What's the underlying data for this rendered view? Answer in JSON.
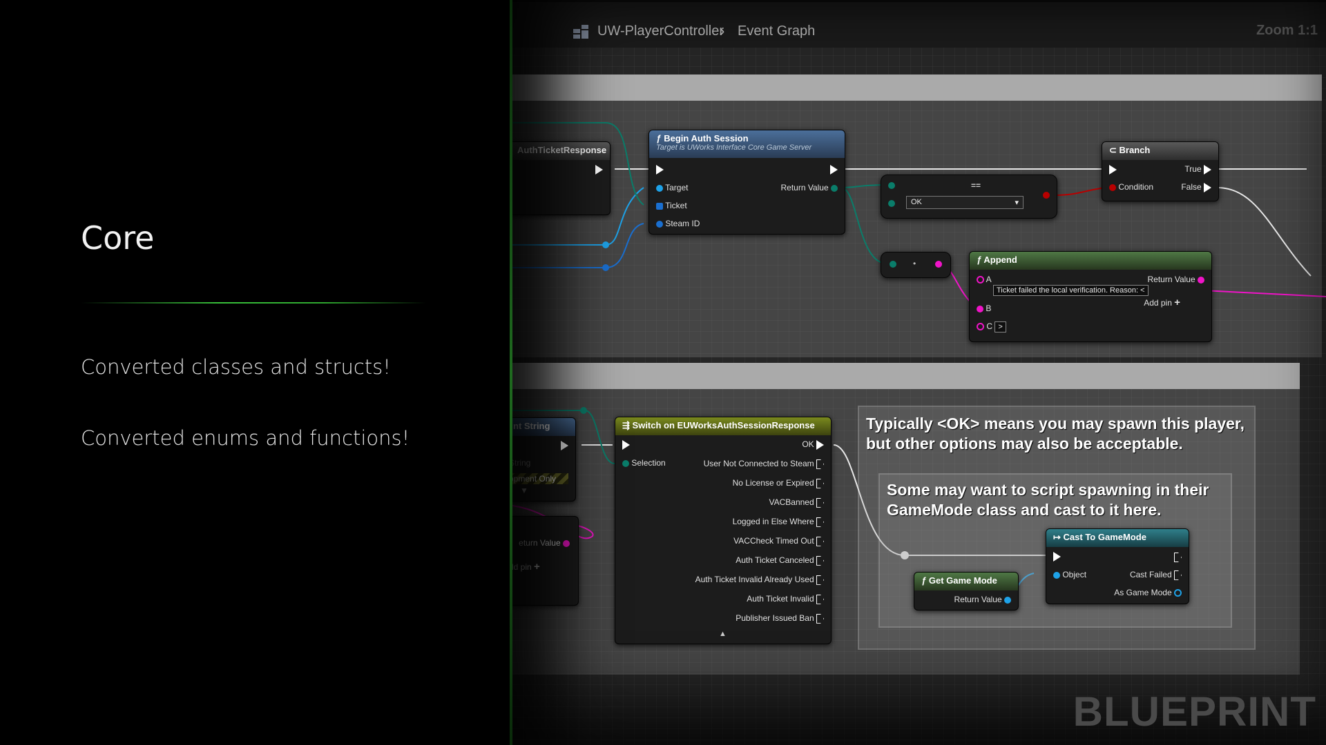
{
  "slide": {
    "title": "Core",
    "bullets": [
      "Converted classes and structs!",
      "Converted enums and functions!"
    ]
  },
  "editor": {
    "breadcrumb": [
      "UW-PlayerController",
      "Event Graph"
    ],
    "zoom": "Zoom 1:1",
    "watermark": "BLUEPRINT"
  },
  "colors": {
    "accent_green": "#38c03a",
    "exec_pin": "#ffffff",
    "object_pin": "#1ea2e8",
    "string_pin": "#f014c8",
    "bool_pin": "#b80000",
    "enum_pin": "#0a7d6a"
  },
  "nodes": {
    "auth_response": {
      "title": "AuthTicketResponse"
    },
    "begin_auth": {
      "title": "Begin Auth Session",
      "subtitle": "Target is UWorks Interface Core Game Server",
      "target": "Target",
      "ticket": "Ticket",
      "steam_id": "Steam ID",
      "return_value": "Return Value"
    },
    "equal": {
      "value": "OK",
      "symbol": "=="
    },
    "branch": {
      "title": "Branch",
      "condition": "Condition",
      "true_label": "True",
      "false_label": "False"
    },
    "append": {
      "title": "Append",
      "a": "A",
      "a_value": "Ticket failed the local verification. Reason: <",
      "b": "B",
      "c": "C",
      "c_value": ">",
      "return_value": "Return Value",
      "add_pin": "Add pin"
    },
    "print_string": {
      "title": "nt String",
      "string": "String",
      "dev_only": "opment Only"
    },
    "append2": {
      "return_value": "eturn Value",
      "add_pin": "dd pin"
    },
    "switch": {
      "title": "Switch on EUWorksAuthSessionResponse",
      "selection": "Selection",
      "outputs": [
        "OK",
        "User Not Connected to Steam",
        "No License or Expired",
        "VACBanned",
        "Logged in Else Where",
        "VACCheck Timed Out",
        "Auth Ticket Canceled",
        "Auth Ticket Invalid Already Used",
        "Auth Ticket Invalid",
        "Publisher Issued Ban"
      ]
    },
    "get_game_mode": {
      "title": "Get Game Mode",
      "return_value": "Return Value"
    },
    "cast": {
      "title": "Cast To GameMode",
      "object": "Object",
      "cast_failed": "Cast Failed",
      "as_game_mode": "As Game Mode"
    }
  },
  "notes": {
    "note1": "Typically <OK> means you may spawn this player, but other options may also be acceptable.",
    "note2": "Some may want to script spawning in their GameMode class and cast to it here."
  }
}
